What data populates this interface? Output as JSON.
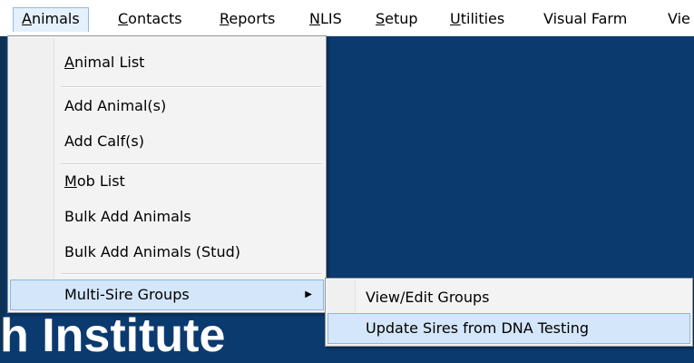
{
  "menubar": {
    "items": [
      {
        "label": "Animals",
        "active": true
      },
      {
        "label": "Contacts"
      },
      {
        "label": "Reports"
      },
      {
        "label": "NLIS"
      },
      {
        "label": "Setup"
      },
      {
        "label": "Utilities"
      },
      {
        "label": "Visual Farm"
      },
      {
        "label": "Vie"
      }
    ]
  },
  "animals_menu": {
    "items": [
      {
        "label": "Animal List"
      },
      {
        "label": "Add Animal(s)"
      },
      {
        "label": "Add Calf(s)"
      },
      {
        "label": "Mob List"
      },
      {
        "label": "Bulk Add Animals"
      },
      {
        "label": "Bulk Add Animals (Stud)"
      },
      {
        "label": "Multi-Sire Groups",
        "has_submenu": true,
        "highlighted": true
      }
    ]
  },
  "multisire_submenu": {
    "items": [
      {
        "label": "View/Edit Groups"
      },
      {
        "label": "Update Sires from DNA Testing",
        "highlighted": true
      }
    ]
  },
  "background": {
    "heading": "h Institute"
  },
  "colors": {
    "desktop_bg": "#0b3a6f",
    "menu_bg": "#f3f3f3",
    "highlight_bg": "#d4e6f9",
    "highlight_border": "#89b6e2"
  }
}
